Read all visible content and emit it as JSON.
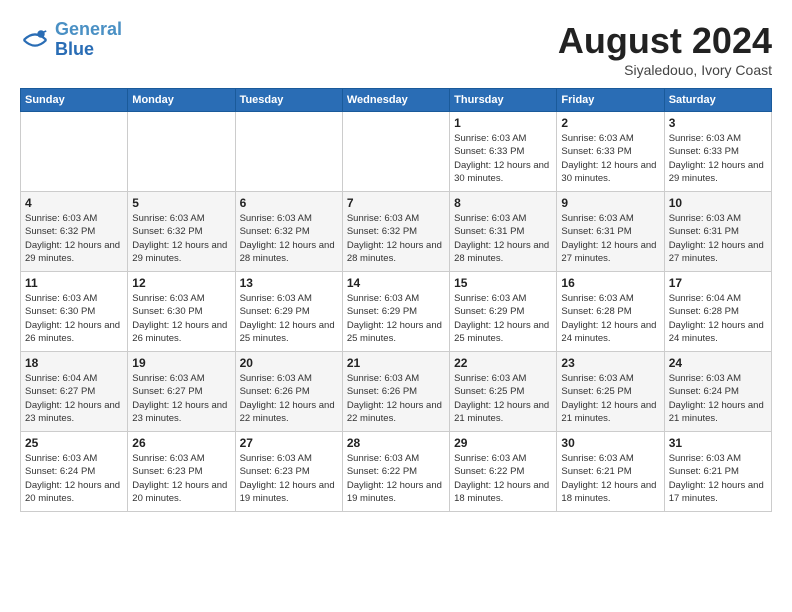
{
  "header": {
    "logo_line1": "General",
    "logo_line2": "Blue",
    "month_title": "August 2024",
    "location": "Siyaledouo, Ivory Coast"
  },
  "weekdays": [
    "Sunday",
    "Monday",
    "Tuesday",
    "Wednesday",
    "Thursday",
    "Friday",
    "Saturday"
  ],
  "weeks": [
    [
      {
        "day": "",
        "sunrise": "",
        "sunset": "",
        "daylight": ""
      },
      {
        "day": "",
        "sunrise": "",
        "sunset": "",
        "daylight": ""
      },
      {
        "day": "",
        "sunrise": "",
        "sunset": "",
        "daylight": ""
      },
      {
        "day": "",
        "sunrise": "",
        "sunset": "",
        "daylight": ""
      },
      {
        "day": "1",
        "sunrise": "Sunrise: 6:03 AM",
        "sunset": "Sunset: 6:33 PM",
        "daylight": "Daylight: 12 hours and 30 minutes."
      },
      {
        "day": "2",
        "sunrise": "Sunrise: 6:03 AM",
        "sunset": "Sunset: 6:33 PM",
        "daylight": "Daylight: 12 hours and 30 minutes."
      },
      {
        "day": "3",
        "sunrise": "Sunrise: 6:03 AM",
        "sunset": "Sunset: 6:33 PM",
        "daylight": "Daylight: 12 hours and 29 minutes."
      }
    ],
    [
      {
        "day": "4",
        "sunrise": "Sunrise: 6:03 AM",
        "sunset": "Sunset: 6:32 PM",
        "daylight": "Daylight: 12 hours and 29 minutes."
      },
      {
        "day": "5",
        "sunrise": "Sunrise: 6:03 AM",
        "sunset": "Sunset: 6:32 PM",
        "daylight": "Daylight: 12 hours and 29 minutes."
      },
      {
        "day": "6",
        "sunrise": "Sunrise: 6:03 AM",
        "sunset": "Sunset: 6:32 PM",
        "daylight": "Daylight: 12 hours and 28 minutes."
      },
      {
        "day": "7",
        "sunrise": "Sunrise: 6:03 AM",
        "sunset": "Sunset: 6:32 PM",
        "daylight": "Daylight: 12 hours and 28 minutes."
      },
      {
        "day": "8",
        "sunrise": "Sunrise: 6:03 AM",
        "sunset": "Sunset: 6:31 PM",
        "daylight": "Daylight: 12 hours and 28 minutes."
      },
      {
        "day": "9",
        "sunrise": "Sunrise: 6:03 AM",
        "sunset": "Sunset: 6:31 PM",
        "daylight": "Daylight: 12 hours and 27 minutes."
      },
      {
        "day": "10",
        "sunrise": "Sunrise: 6:03 AM",
        "sunset": "Sunset: 6:31 PM",
        "daylight": "Daylight: 12 hours and 27 minutes."
      }
    ],
    [
      {
        "day": "11",
        "sunrise": "Sunrise: 6:03 AM",
        "sunset": "Sunset: 6:30 PM",
        "daylight": "Daylight: 12 hours and 26 minutes."
      },
      {
        "day": "12",
        "sunrise": "Sunrise: 6:03 AM",
        "sunset": "Sunset: 6:30 PM",
        "daylight": "Daylight: 12 hours and 26 minutes."
      },
      {
        "day": "13",
        "sunrise": "Sunrise: 6:03 AM",
        "sunset": "Sunset: 6:29 PM",
        "daylight": "Daylight: 12 hours and 25 minutes."
      },
      {
        "day": "14",
        "sunrise": "Sunrise: 6:03 AM",
        "sunset": "Sunset: 6:29 PM",
        "daylight": "Daylight: 12 hours and 25 minutes."
      },
      {
        "day": "15",
        "sunrise": "Sunrise: 6:03 AM",
        "sunset": "Sunset: 6:29 PM",
        "daylight": "Daylight: 12 hours and 25 minutes."
      },
      {
        "day": "16",
        "sunrise": "Sunrise: 6:03 AM",
        "sunset": "Sunset: 6:28 PM",
        "daylight": "Daylight: 12 hours and 24 minutes."
      },
      {
        "day": "17",
        "sunrise": "Sunrise: 6:04 AM",
        "sunset": "Sunset: 6:28 PM",
        "daylight": "Daylight: 12 hours and 24 minutes."
      }
    ],
    [
      {
        "day": "18",
        "sunrise": "Sunrise: 6:04 AM",
        "sunset": "Sunset: 6:27 PM",
        "daylight": "Daylight: 12 hours and 23 minutes."
      },
      {
        "day": "19",
        "sunrise": "Sunrise: 6:03 AM",
        "sunset": "Sunset: 6:27 PM",
        "daylight": "Daylight: 12 hours and 23 minutes."
      },
      {
        "day": "20",
        "sunrise": "Sunrise: 6:03 AM",
        "sunset": "Sunset: 6:26 PM",
        "daylight": "Daylight: 12 hours and 22 minutes."
      },
      {
        "day": "21",
        "sunrise": "Sunrise: 6:03 AM",
        "sunset": "Sunset: 6:26 PM",
        "daylight": "Daylight: 12 hours and 22 minutes."
      },
      {
        "day": "22",
        "sunrise": "Sunrise: 6:03 AM",
        "sunset": "Sunset: 6:25 PM",
        "daylight": "Daylight: 12 hours and 21 minutes."
      },
      {
        "day": "23",
        "sunrise": "Sunrise: 6:03 AM",
        "sunset": "Sunset: 6:25 PM",
        "daylight": "Daylight: 12 hours and 21 minutes."
      },
      {
        "day": "24",
        "sunrise": "Sunrise: 6:03 AM",
        "sunset": "Sunset: 6:24 PM",
        "daylight": "Daylight: 12 hours and 21 minutes."
      }
    ],
    [
      {
        "day": "25",
        "sunrise": "Sunrise: 6:03 AM",
        "sunset": "Sunset: 6:24 PM",
        "daylight": "Daylight: 12 hours and 20 minutes."
      },
      {
        "day": "26",
        "sunrise": "Sunrise: 6:03 AM",
        "sunset": "Sunset: 6:23 PM",
        "daylight": "Daylight: 12 hours and 20 minutes."
      },
      {
        "day": "27",
        "sunrise": "Sunrise: 6:03 AM",
        "sunset": "Sunset: 6:23 PM",
        "daylight": "Daylight: 12 hours and 19 minutes."
      },
      {
        "day": "28",
        "sunrise": "Sunrise: 6:03 AM",
        "sunset": "Sunset: 6:22 PM",
        "daylight": "Daylight: 12 hours and 19 minutes."
      },
      {
        "day": "29",
        "sunrise": "Sunrise: 6:03 AM",
        "sunset": "Sunset: 6:22 PM",
        "daylight": "Daylight: 12 hours and 18 minutes."
      },
      {
        "day": "30",
        "sunrise": "Sunrise: 6:03 AM",
        "sunset": "Sunset: 6:21 PM",
        "daylight": "Daylight: 12 hours and 18 minutes."
      },
      {
        "day": "31",
        "sunrise": "Sunrise: 6:03 AM",
        "sunset": "Sunset: 6:21 PM",
        "daylight": "Daylight: 12 hours and 17 minutes."
      }
    ]
  ]
}
